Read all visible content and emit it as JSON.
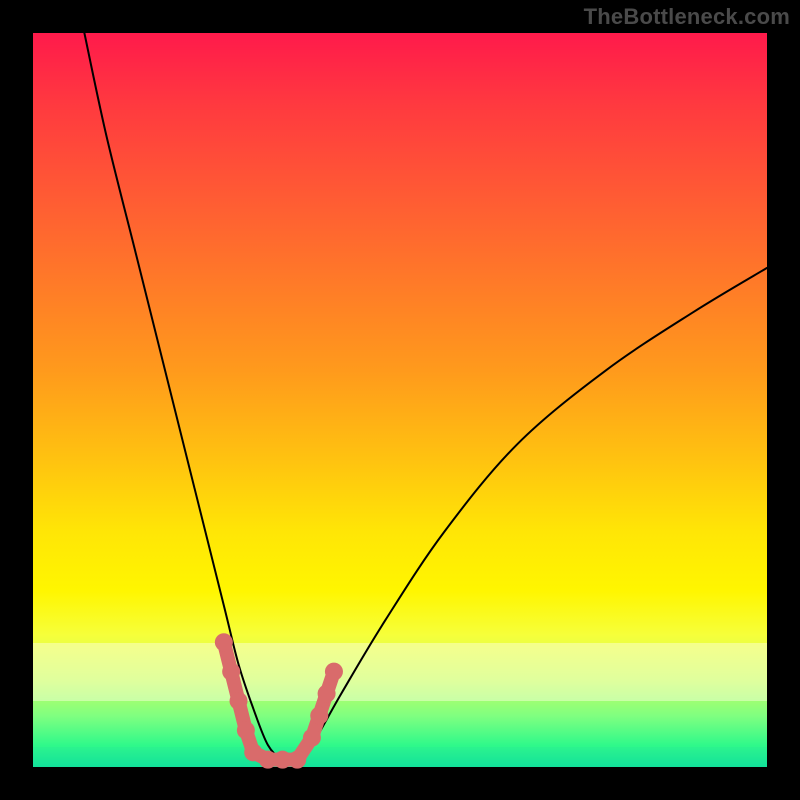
{
  "watermark": "TheBottleneck.com",
  "chart_data": {
    "type": "line",
    "title": "",
    "xlabel": "",
    "ylabel": "",
    "xlim": [
      0,
      100
    ],
    "ylim": [
      0,
      100
    ],
    "grid": false,
    "legend": false,
    "series": [
      {
        "name": "bottleneck-curve",
        "x": [
          7,
          10,
          14,
          18,
          22,
          26,
          28,
          30,
          32,
          34,
          36,
          38,
          42,
          48,
          56,
          66,
          78,
          90,
          100
        ],
        "values": [
          100,
          86,
          70,
          54,
          38,
          22,
          14,
          8,
          3,
          1,
          1,
          3,
          10,
          20,
          32,
          44,
          54,
          62,
          68
        ]
      }
    ],
    "markers": {
      "name": "highlight-dots",
      "color": "#d96b6b",
      "points": [
        {
          "x": 26,
          "y": 17
        },
        {
          "x": 27,
          "y": 13
        },
        {
          "x": 28,
          "y": 9
        },
        {
          "x": 29,
          "y": 5
        },
        {
          "x": 30,
          "y": 2
        },
        {
          "x": 32,
          "y": 1
        },
        {
          "x": 34,
          "y": 1
        },
        {
          "x": 36,
          "y": 1
        },
        {
          "x": 38,
          "y": 4
        },
        {
          "x": 39,
          "y": 7
        },
        {
          "x": 40,
          "y": 10
        },
        {
          "x": 41,
          "y": 13
        }
      ]
    },
    "background_gradient": {
      "top": "#ff1a4b",
      "mid": "#ffe606",
      "bottom": "#18e898"
    }
  }
}
